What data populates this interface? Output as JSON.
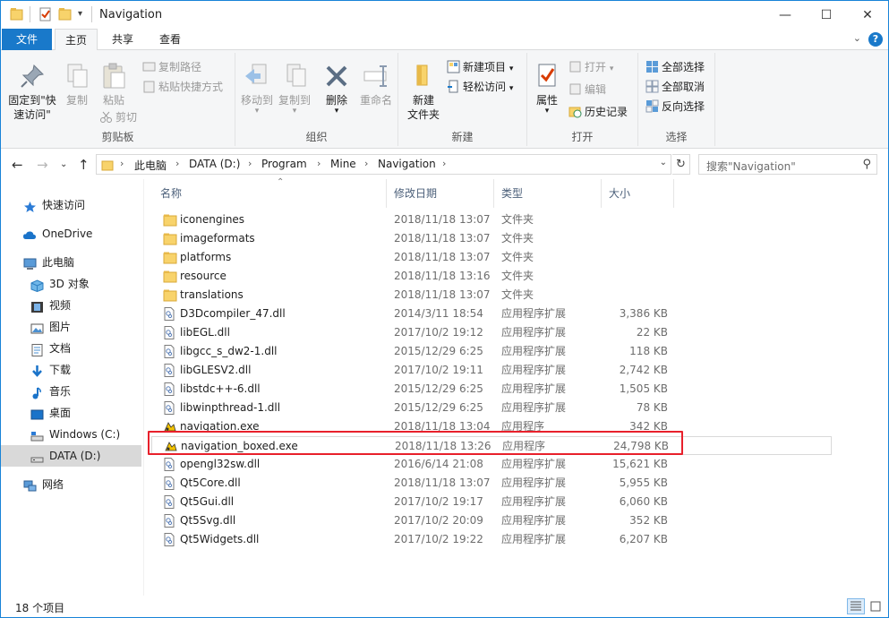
{
  "window": {
    "title": "Navigation",
    "controls": {
      "minimize": "—",
      "maximize": "☐",
      "close": "✕"
    }
  },
  "ribbon_tabs": [
    {
      "label": "文件"
    },
    {
      "label": "主页"
    },
    {
      "label": "共享"
    },
    {
      "label": "查看"
    }
  ],
  "ribbon": {
    "clipboard": {
      "pin": "固定到\"快速访问\"",
      "copy": "复制",
      "paste": "粘贴",
      "copy_path": "复制路径",
      "paste_shortcut": "粘贴快捷方式",
      "cut": "剪切",
      "label": "剪贴板"
    },
    "organize": {
      "move_to": "移动到",
      "copy_to": "复制到",
      "delete": "删除",
      "rename": "重命名",
      "label": "组织"
    },
    "new": {
      "new_folder": "新建\n文件夹",
      "new_item": "新建项目",
      "easy_access": "轻松访问",
      "label": "新建"
    },
    "open": {
      "properties": "属性",
      "open": "打开",
      "edit": "编辑",
      "history": "历史记录",
      "label": "打开"
    },
    "select": {
      "select_all": "全部选择",
      "select_none": "全部取消",
      "invert": "反向选择",
      "label": "选择"
    }
  },
  "address": {
    "crumbs": [
      "此电脑",
      "DATA (D:)",
      "Program",
      "Mine",
      "Navigation"
    ],
    "search_placeholder": "搜索\"Navigation\""
  },
  "sidebar": {
    "items": [
      {
        "label": "快速访问",
        "icon": "star-icon"
      },
      {
        "label": "OneDrive",
        "icon": "cloud-icon"
      },
      {
        "label": "此电脑",
        "icon": "computer-icon"
      },
      {
        "label": "3D 对象",
        "icon": "cube-icon"
      },
      {
        "label": "视频",
        "icon": "video-icon"
      },
      {
        "label": "图片",
        "icon": "picture-icon"
      },
      {
        "label": "文档",
        "icon": "document-icon"
      },
      {
        "label": "下载",
        "icon": "download-icon"
      },
      {
        "label": "音乐",
        "icon": "music-icon"
      },
      {
        "label": "桌面",
        "icon": "desktop-icon"
      },
      {
        "label": "Windows (C:)",
        "icon": "drive-icon"
      },
      {
        "label": "DATA (D:)",
        "icon": "drive-icon"
      },
      {
        "label": "网络",
        "icon": "network-icon"
      }
    ]
  },
  "columns": {
    "name": "名称",
    "date": "修改日期",
    "type": "类型",
    "size": "大小"
  },
  "files": [
    {
      "name": "iconengines",
      "date": "2018/11/18 13:07",
      "type": "文件夹",
      "size": "",
      "kind": "folder"
    },
    {
      "name": "imageformats",
      "date": "2018/11/18 13:07",
      "type": "文件夹",
      "size": "",
      "kind": "folder"
    },
    {
      "name": "platforms",
      "date": "2018/11/18 13:07",
      "type": "文件夹",
      "size": "",
      "kind": "folder"
    },
    {
      "name": "resource",
      "date": "2018/11/18 13:16",
      "type": "文件夹",
      "size": "",
      "kind": "folder"
    },
    {
      "name": "translations",
      "date": "2018/11/18 13:07",
      "type": "文件夹",
      "size": "",
      "kind": "folder"
    },
    {
      "name": "D3Dcompiler_47.dll",
      "date": "2014/3/11 18:54",
      "type": "应用程序扩展",
      "size": "3,386 KB",
      "kind": "dll"
    },
    {
      "name": "libEGL.dll",
      "date": "2017/10/2 19:12",
      "type": "应用程序扩展",
      "size": "22 KB",
      "kind": "dll"
    },
    {
      "name": "libgcc_s_dw2-1.dll",
      "date": "2015/12/29 6:25",
      "type": "应用程序扩展",
      "size": "118 KB",
      "kind": "dll"
    },
    {
      "name": "libGLESV2.dll",
      "date": "2017/10/2 19:11",
      "type": "应用程序扩展",
      "size": "2,742 KB",
      "kind": "dll"
    },
    {
      "name": "libstdc++-6.dll",
      "date": "2015/12/29 6:25",
      "type": "应用程序扩展",
      "size": "1,505 KB",
      "kind": "dll"
    },
    {
      "name": "libwinpthread-1.dll",
      "date": "2015/12/29 6:25",
      "type": "应用程序扩展",
      "size": "78 KB",
      "kind": "dll"
    },
    {
      "name": "navigation.exe",
      "date": "2018/11/18 13:04",
      "type": "应用程序",
      "size": "342 KB",
      "kind": "exe"
    },
    {
      "name": "navigation_boxed.exe",
      "date": "2018/11/18 13:26",
      "type": "应用程序",
      "size": "24,798 KB",
      "kind": "exe"
    },
    {
      "name": "opengl32sw.dll",
      "date": "2016/6/14 21:08",
      "type": "应用程序扩展",
      "size": "15,621 KB",
      "kind": "dll"
    },
    {
      "name": "Qt5Core.dll",
      "date": "2018/11/18 13:07",
      "type": "应用程序扩展",
      "size": "5,955 KB",
      "kind": "dll"
    },
    {
      "name": "Qt5Gui.dll",
      "date": "2017/10/2 19:17",
      "type": "应用程序扩展",
      "size": "6,060 KB",
      "kind": "dll"
    },
    {
      "name": "Qt5Svg.dll",
      "date": "2017/10/2 20:09",
      "type": "应用程序扩展",
      "size": "352 KB",
      "kind": "dll"
    },
    {
      "name": "Qt5Widgets.dll",
      "date": "2017/10/2 19:22",
      "type": "应用程序扩展",
      "size": "6,207 KB",
      "kind": "dll"
    }
  ],
  "status": {
    "count": "18 个项目"
  },
  "colors": {
    "accent": "#1979ca",
    "highlight_box": "#e8202b",
    "folder": "#f8d36b"
  }
}
